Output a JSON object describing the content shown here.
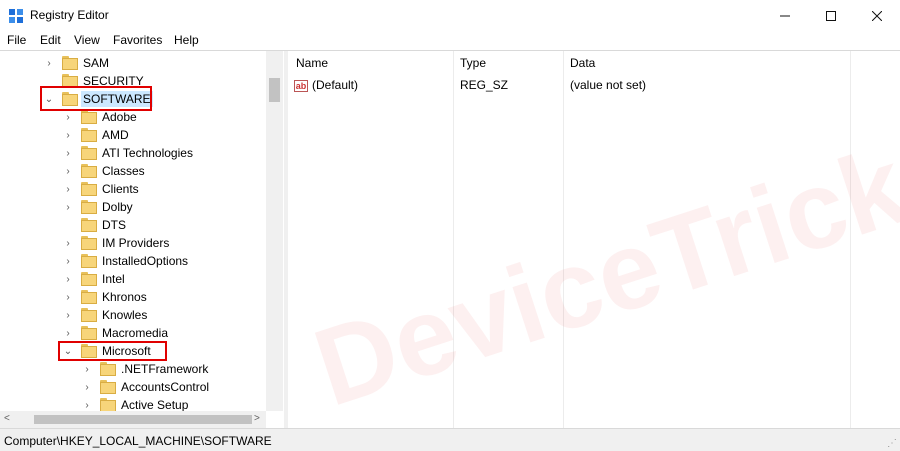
{
  "window": {
    "title": "Registry Editor"
  },
  "menu": [
    "File",
    "Edit",
    "View",
    "Favorites",
    "Help"
  ],
  "tree": [
    {
      "label": "SAM",
      "depth": 0,
      "arrow": "collapsed"
    },
    {
      "label": "SECURITY",
      "depth": 0,
      "arrow": "none"
    },
    {
      "label": "SOFTWARE",
      "depth": 0,
      "arrow": "expanded",
      "selected": true
    },
    {
      "label": "Adobe",
      "depth": 1,
      "arrow": "collapsed"
    },
    {
      "label": "AMD",
      "depth": 1,
      "arrow": "collapsed"
    },
    {
      "label": "ATI Technologies",
      "depth": 1,
      "arrow": "collapsed"
    },
    {
      "label": "Classes",
      "depth": 1,
      "arrow": "collapsed"
    },
    {
      "label": "Clients",
      "depth": 1,
      "arrow": "collapsed"
    },
    {
      "label": "Dolby",
      "depth": 1,
      "arrow": "collapsed"
    },
    {
      "label": "DTS",
      "depth": 1,
      "arrow": "none"
    },
    {
      "label": "IM Providers",
      "depth": 1,
      "arrow": "collapsed"
    },
    {
      "label": "InstalledOptions",
      "depth": 1,
      "arrow": "collapsed"
    },
    {
      "label": "Intel",
      "depth": 1,
      "arrow": "collapsed"
    },
    {
      "label": "Khronos",
      "depth": 1,
      "arrow": "collapsed"
    },
    {
      "label": "Knowles",
      "depth": 1,
      "arrow": "collapsed"
    },
    {
      "label": "Macromedia",
      "depth": 1,
      "arrow": "collapsed"
    },
    {
      "label": "Microsoft",
      "depth": 1,
      "arrow": "expanded"
    },
    {
      "label": ".NETFramework",
      "depth": 2,
      "arrow": "collapsed"
    },
    {
      "label": "AccountsControl",
      "depth": 2,
      "arrow": "collapsed"
    },
    {
      "label": "Active Setup",
      "depth": 2,
      "arrow": "collapsed"
    }
  ],
  "list": {
    "headers": [
      "Name",
      "Type",
      "Data"
    ],
    "rows": [
      {
        "name": "(Default)",
        "type": "REG_SZ",
        "data": "(value not set)",
        "icon": "string-value-icon"
      }
    ]
  },
  "status": {
    "path": "Computer\\HKEY_LOCAL_MACHINE\\SOFTWARE"
  },
  "watermark": "DeviceTricks",
  "colors": {
    "selection": "#cce8ff",
    "highlight_box": "#e00000",
    "folder": "#f7d57a"
  }
}
